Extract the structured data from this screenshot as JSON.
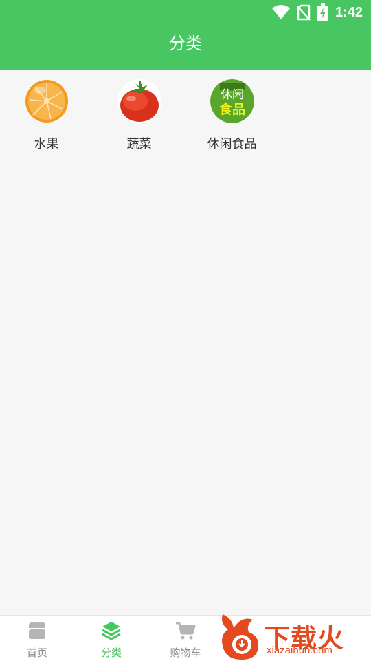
{
  "status_bar": {
    "time": "1:42",
    "icons": [
      "wifi-icon",
      "no-sim-icon",
      "battery-charging-icon"
    ]
  },
  "header": {
    "title": "分类",
    "color": "#47c662"
  },
  "categories": [
    {
      "label": "水果",
      "icon": "orange-image"
    },
    {
      "label": "蔬菜",
      "icon": "tomato-image"
    },
    {
      "label": "休闲食品",
      "icon": "snack-food-image",
      "image_text": [
        "休闲",
        "食品"
      ]
    }
  ],
  "bottom_nav": {
    "items": [
      {
        "label": "首页",
        "icon": "home-shop-icon",
        "active": false
      },
      {
        "label": "分类",
        "icon": "layers-icon",
        "active": true
      },
      {
        "label": "购物车",
        "icon": "cart-icon",
        "active": false
      }
    ],
    "active_color": "#47c662",
    "inactive_color": "#8a8a8a"
  },
  "watermark": {
    "title": "下载火",
    "url": "xiazaihuo.com"
  }
}
